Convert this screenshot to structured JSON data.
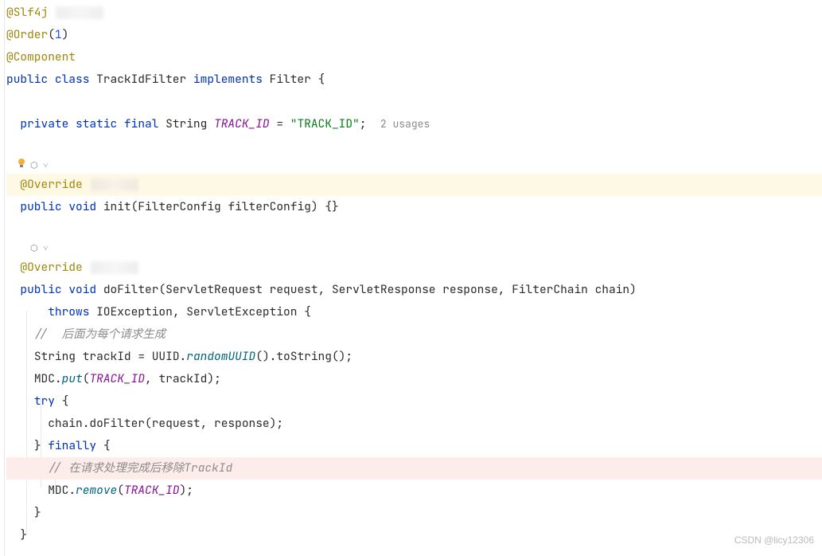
{
  "code": {
    "anno_slf4j": "@Slf4j",
    "anno_order": "@Order",
    "order_num": "1",
    "anno_component": "@Component",
    "kw_public": "public",
    "kw_class": "class",
    "class_name": "TrackIdFilter",
    "kw_implements": "implements",
    "iface_filter": "Filter",
    "brace_open": "{",
    "brace_close": "}",
    "kw_private": "private",
    "kw_static": "static",
    "kw_final": "final",
    "type_string": "String",
    "field_track_id": "TRACK_ID",
    "eq": " = ",
    "str_track_id": "\"TRACK_ID\"",
    "semi": ";",
    "hint_usages": "2 usages",
    "anno_override": "@Override",
    "kw_void": "void",
    "method_init": "init",
    "param_fc_type": "FilterConfig",
    "param_fc_name": "filterConfig",
    "empty_body": "{}",
    "method_dofilter": "doFilter",
    "param_req_type": "ServletRequest",
    "param_req_name": "request",
    "param_resp_type": "ServletResponse",
    "param_resp_name": "response",
    "param_chain_type": "FilterChain",
    "param_chain_name": "chain",
    "kw_throws": "throws",
    "exc_io": "IOException",
    "exc_servlet": "ServletException",
    "comment_gen": "//  后面为每个请求生成",
    "var_trackid": "trackId",
    "uuid_class": "UUID",
    "method_randomuuid": "randomUUID",
    "method_tostring": "toString",
    "mdc_class": "MDC",
    "method_put": "put",
    "kw_try": "try",
    "chain_var": "chain",
    "dofilter_call": "doFilter",
    "kw_finally": "finally",
    "comment_remove": "// 在请求处理完成后移除TrackId",
    "method_remove": "remove",
    "paren_open": "(",
    "paren_close": ")",
    "comma": ", ",
    "dot": "."
  },
  "watermark": "CSDN @licy12306"
}
